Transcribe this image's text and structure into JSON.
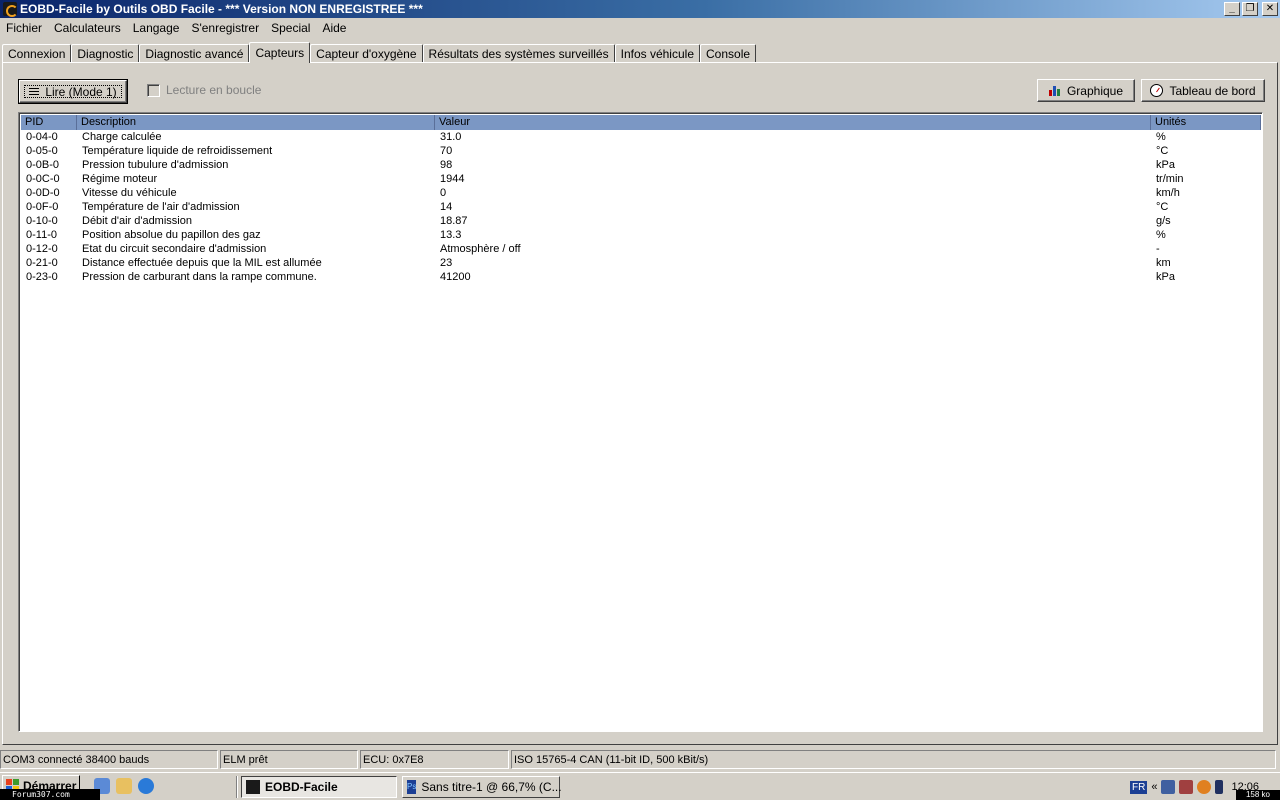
{
  "window": {
    "title": "EOBD-Facile by Outils OBD Facile - *** Version NON ENREGISTREE ***"
  },
  "menu": [
    "Fichier",
    "Calculateurs",
    "Langage",
    "S'enregistrer",
    "Special",
    "Aide"
  ],
  "tabs": [
    {
      "label": "Connexion"
    },
    {
      "label": "Diagnostic"
    },
    {
      "label": "Diagnostic avancé"
    },
    {
      "label": "Capteurs",
      "active": true
    },
    {
      "label": "Capteur d'oxygène"
    },
    {
      "label": "Résultats des systèmes surveillés"
    },
    {
      "label": "Infos véhicule"
    },
    {
      "label": "Console"
    }
  ],
  "toolbar": {
    "read_label": "Lire (Mode 1)",
    "loop_label": "Lecture en boucle",
    "graph_label": "Graphique",
    "dashboard_label": "Tableau de bord"
  },
  "table": {
    "columns": [
      "PID",
      "Description",
      "Valeur",
      "Unités"
    ],
    "rows": [
      [
        "0-04-0",
        "Charge calculée",
        "31.0",
        "%"
      ],
      [
        "0-05-0",
        "Température liquide de refroidissement",
        "70",
        "°C"
      ],
      [
        "0-0B-0",
        "Pression tubulure d'admission",
        "98",
        "kPa"
      ],
      [
        "0-0C-0",
        "Régime moteur",
        "1944",
        "tr/min"
      ],
      [
        "0-0D-0",
        "Vitesse du véhicule",
        "0",
        "km/h"
      ],
      [
        "0-0F-0",
        "Température de l'air d'admission",
        "14",
        "°C"
      ],
      [
        "0-10-0",
        "Débit d'air d'admission",
        "18.87",
        "g/s"
      ],
      [
        "0-11-0",
        "Position absolue du papillon des gaz",
        "13.3",
        "%"
      ],
      [
        "0-12-0",
        "Etat du circuit secondaire d'admission",
        "Atmosphère / off",
        "-"
      ],
      [
        "0-21-0",
        "Distance effectuée depuis que la MIL est allumée",
        "23",
        "km"
      ],
      [
        "0-23-0",
        "Pression de carburant dans la rampe commune.",
        "41200",
        "kPa"
      ]
    ]
  },
  "status": {
    "port": "COM3 connecté 38400 bauds",
    "elm": "ELM prêt",
    "ecu": "ECU: 0x7E8",
    "protocol": "ISO 15765-4 CAN (11-bit ID, 500 kBit/s)"
  },
  "taskbar": {
    "start_label": "Démarrer",
    "forum_tag": "Forum307.com",
    "tasks": [
      "EOBD-Facile",
      "Sans titre-1 @ 66,7% (C..."
    ],
    "lang": "FR",
    "chevron": "«",
    "clock": "12:06",
    "kb_tag": "158 ko"
  },
  "colors": {
    "header_bg": "#7b97c4",
    "title_gradient_start": "#0a246a",
    "title_gradient_end": "#a6caf0"
  }
}
